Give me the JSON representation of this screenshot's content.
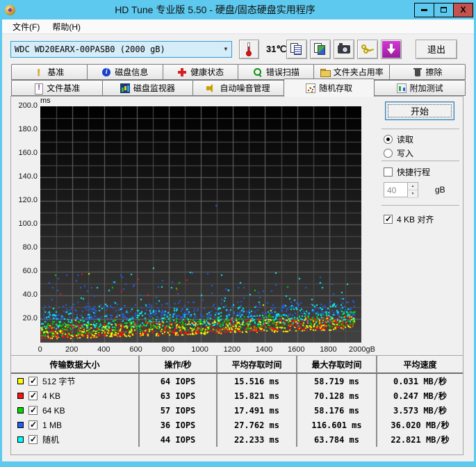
{
  "window": {
    "title": "HD Tune 专业版 5.50 - 硬盘/固态硬盘实用程序",
    "controls": {
      "minimize": "minimize",
      "maximize": "maximize",
      "close": "x"
    }
  },
  "menu": {
    "items": [
      {
        "label": "文件(F)"
      },
      {
        "label": "帮助(H)"
      }
    ]
  },
  "toolbar": {
    "drive_select": "WDC WD20EARX-00PASB0 (2000 gB)",
    "temperature": "31℃",
    "buttons": [
      "copy-text",
      "copy-image",
      "screenshot",
      "register-keys",
      "download"
    ],
    "exit_label": "退出"
  },
  "tabs": {
    "active": "随机存取",
    "row1": [
      {
        "id": "benchmark",
        "label": "基准",
        "icon": "exclamation-icon",
        "cls": "ic-exclaim"
      },
      {
        "id": "disk-info",
        "label": "磁盘信息",
        "icon": "info-icon",
        "cls": "ic-info"
      },
      {
        "id": "health",
        "label": "健康状态",
        "icon": "health-cross-icon",
        "cls": "ic-cross"
      },
      {
        "id": "error-scan",
        "label": "错误扫描",
        "icon": "magnifier-icon",
        "cls": "ic-magnifier"
      },
      {
        "id": "folder-usage",
        "label": "文件夹占用率",
        "icon": "folder-icon",
        "cls": "ic-folder"
      },
      {
        "id": "erase",
        "label": "擦除",
        "icon": "trash-icon",
        "cls": "ic-trash"
      }
    ],
    "row2": [
      {
        "id": "file-benchmark",
        "label": "文件基准",
        "icon": "file-exclamation-icon",
        "cls": "ic-filebench"
      },
      {
        "id": "disk-monitor",
        "label": "磁盘监视器",
        "icon": "bar-chart-icon",
        "cls": "ic-bars"
      },
      {
        "id": "aam",
        "label": "自动噪音管理",
        "icon": "speaker-icon",
        "cls": "ic-speaker"
      },
      {
        "id": "random-access",
        "label": "随机存取",
        "icon": "scatter-icon",
        "cls": "ic-scatter"
      },
      {
        "id": "extra-tests",
        "label": "附加测试",
        "icon": "chart-grid-icon",
        "cls": "ic-extra"
      }
    ]
  },
  "controls": {
    "start_label": "开始",
    "read_label": "读取",
    "write_label": "写入",
    "read_selected": true,
    "short_stroke_label": "快捷行程",
    "short_stroke_checked": false,
    "short_stroke_value": "40",
    "short_stroke_unit": "gB",
    "align_label": "4 KB 对齐",
    "align_checked": true
  },
  "chart_data": {
    "type": "scatter",
    "title": "",
    "xlabel": "gB",
    "ylabel": "ms",
    "xlim": [
      0,
      2000
    ],
    "ylim": [
      0,
      200
    ],
    "x_tick_step": 200,
    "x_last_tick_label": "2000gB",
    "y_tick_step": 20,
    "grid": {
      "x_minor_step": 100,
      "y_minor_step": 10,
      "on": true
    },
    "legend_position": "bottom-table",
    "series": [
      {
        "name": "512 字节",
        "color": "#ffff00",
        "iops": 64,
        "avg_ms": 15.516,
        "max_ms": 58.719,
        "avg_speed_mb_s": 0.031,
        "gen": {
          "count": 430,
          "min0": 3.5,
          "min1": 12,
          "spread": 11,
          "tail_p": 0.02,
          "tail_max": 46
        },
        "max_point": [
          300,
          58.7
        ]
      },
      {
        "name": "4 KB",
        "color": "#ff1010",
        "iops": 63,
        "avg_ms": 15.821,
        "max_ms": 70.128,
        "avg_speed_mb_s": 0.247,
        "gen": {
          "count": 430,
          "min0": 4,
          "min1": 13,
          "spread": 11,
          "tail_p": 0.02,
          "tail_max": 56
        },
        "max_point": [
          255,
          58.0
        ]
      },
      {
        "name": "64 KB",
        "color": "#00dd00",
        "iops": 57,
        "avg_ms": 17.491,
        "max_ms": 58.176,
        "avg_speed_mb_s": 3.573,
        "gen": {
          "count": 430,
          "min0": 6,
          "min1": 15,
          "spread": 12,
          "tail_p": 0.03,
          "tail_max": 56
        },
        "max_point": [
          90,
          57.5
        ]
      },
      {
        "name": "1 MB",
        "color": "#2060f0",
        "iops": 36,
        "avg_ms": 27.762,
        "max_ms": 116.601,
        "avg_speed_mb_s": 36.02,
        "gen": {
          "count": 430,
          "min0": 20,
          "min1": 24,
          "spread": 12,
          "tail_p": 0.14,
          "tail_max": 60
        },
        "max_point": [
          1090,
          116.6
        ]
      },
      {
        "name": "随机",
        "color": "#00ffff",
        "iops": 44,
        "avg_ms": 22.233,
        "max_ms": 63.784,
        "avg_speed_mb_s": 22.821,
        "gen": {
          "count": 430,
          "min0": 12,
          "min1": 18,
          "spread": 15,
          "tail_p": 0.1,
          "tail_max": 60
        },
        "max_point": [
          700,
          63.8
        ]
      }
    ],
    "generation": {
      "seed": 42,
      "x_max_data": 1955,
      "dot_size": 2,
      "bg_top": "#000000",
      "bg_bottom": "#424242",
      "grid_color": "#4f4f4f",
      "grid_major_color": "#6a6a6a"
    }
  },
  "table": {
    "headers": [
      "传输数据大小",
      "操作/秒",
      "平均存取时间",
      "最大存取时间",
      "平均速度"
    ],
    "rows": [
      {
        "color": "#ffff00",
        "checked": true,
        "label": "512 字节",
        "ops": "64 IOPS",
        "avg": "15.516 ms",
        "max": "58.719 ms",
        "speed": "0.031 MB/秒"
      },
      {
        "color": "#ff1010",
        "checked": true,
        "label": "4 KB",
        "ops": "63 IOPS",
        "avg": "15.821 ms",
        "max": "70.128 ms",
        "speed": "0.247 MB/秒"
      },
      {
        "color": "#00dd00",
        "checked": true,
        "label": "64 KB",
        "ops": "57 IOPS",
        "avg": "17.491 ms",
        "max": "58.176 ms",
        "speed": "3.573 MB/秒"
      },
      {
        "color": "#2060f0",
        "checked": true,
        "label": "1 MB",
        "ops": "36 IOPS",
        "avg": "27.762 ms",
        "max": "116.601 ms",
        "speed": "36.020 MB/秒"
      },
      {
        "color": "#00ffff",
        "checked": true,
        "label": "随机",
        "ops": "44 IOPS",
        "avg": "22.233 ms",
        "max": "63.784 ms",
        "speed": "22.821 MB/秒"
      }
    ]
  },
  "colors": {
    "titlebar": "#5ec9ee",
    "close_button": "#c4524e",
    "combo_bg": "#d5ecf9",
    "combo_border": "#2e9bd6"
  }
}
